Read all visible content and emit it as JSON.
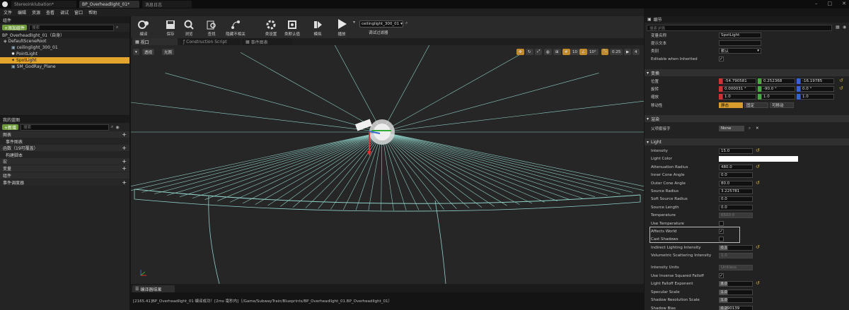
{
  "tabs": [
    {
      "label": "Stereoinklubation*"
    },
    {
      "label": "BP_OverheadlIght_01*"
    },
    {
      "label": "消息日志"
    }
  ],
  "menu": [
    "文件",
    "编辑",
    "资源",
    "查看",
    "调试",
    "窗口",
    "帮助"
  ],
  "components": {
    "header": "组件",
    "add_button": "+添加组件",
    "search_placeholder": "搜索",
    "root": "BP_OverheadlIght_01（自身）",
    "items": [
      "DefaultSceneRoot",
      "ceilinglight_300_01",
      "PointLight",
      "SpotLight",
      "SM_GodRay_Plane"
    ]
  },
  "my_blueprint": {
    "header": "我的蓝图",
    "add_button": "+新增",
    "search_placeholder": "搜索",
    "categories": [
      {
        "label": "图表",
        "sub": "事件图表"
      },
      {
        "label": "函数（19可覆盖）",
        "sub": "构建脚本"
      },
      {
        "label": "宏",
        "sub": ""
      },
      {
        "label": "变量",
        "sub": ""
      },
      {
        "label": "组件",
        "sub": "事件调度器"
      }
    ]
  },
  "toolbar": [
    {
      "label": "编译",
      "icon": "compile-icon"
    },
    {
      "label": "保存",
      "icon": "save-icon"
    },
    {
      "label": "浏览",
      "icon": "browse-icon"
    },
    {
      "label": "查找",
      "icon": "find-icon"
    },
    {
      "label": "隐藏不相关",
      "icon": "hide-unrelated-icon"
    },
    {
      "label": "类设置",
      "icon": "class-settings-icon"
    },
    {
      "label": "类默认值",
      "icon": "class-defaults-icon"
    },
    {
      "label": "模拟",
      "icon": "simulate-icon"
    },
    {
      "label": "播放",
      "icon": "play-icon"
    }
  ],
  "debug_filter": {
    "value": "ceilinglight_300_01",
    "label": "调试过滤器"
  },
  "editor_tabs": [
    "视口",
    "Construction Script",
    "事件图表"
  ],
  "viewport": {
    "perspective": "透视",
    "lit": "光照",
    "grid_snap": "10",
    "rot_snap": "10°",
    "scale_snap": "0.25",
    "cam_speed": "4"
  },
  "compiler": {
    "header": "编译器结果",
    "log": "[2165.41]BP_OverheadlIght_01 编译成功！[2ms 毫秒内]（/Game/SubwayTrain/Blueprints/BP_OverheadlIght_01.BP_OverheadlIght_01）"
  },
  "details": {
    "header": "细节",
    "search_placeholder": "搜索详情",
    "top_rows": [
      {
        "label": "变量名称",
        "value": "SpotLight"
      },
      {
        "label": "提示文本",
        "value": ""
      },
      {
        "label": "类别",
        "value": "默认"
      },
      {
        "label": "Editable when Inherited",
        "value": "✓"
      }
    ],
    "transform": {
      "title": "变换",
      "location": {
        "label": "位置",
        "x": "-54.790581",
        "y": "0.252368",
        "z": "-16.19785"
      },
      "rotation": {
        "label": "旋转",
        "x": "0.000031 °",
        "y": "-90.0 °",
        "z": "0.0 °"
      },
      "scale": {
        "label": "缩放",
        "x": "1.0",
        "y": "1.0",
        "z": "1.0"
      },
      "mobility": {
        "label": "移动性",
        "options": [
          "静态",
          "固定",
          "可移动"
        ]
      }
    },
    "tags": {
      "title": "渲染",
      "label": "父项套接字",
      "value": "None"
    },
    "light": {
      "title": "Light",
      "rows": [
        {
          "label": "Intensity",
          "value": "15.0"
        },
        {
          "label": "Light Color",
          "value": ""
        },
        {
          "label": "Attenuation Radius",
          "value": "480.0"
        },
        {
          "label": "Inner Cone Angle",
          "value": "0.0"
        },
        {
          "label": "Outer Cone Angle",
          "value": "80.0"
        },
        {
          "label": "Source Radius",
          "value": "3.225781"
        },
        {
          "label": "Soft Source Radius",
          "value": "0.0"
        },
        {
          "label": "Source Length",
          "value": "0.0"
        },
        {
          "label": "Temperature",
          "value": "6500.0"
        },
        {
          "label": "Use Temperature",
          "value": ""
        },
        {
          "label": "Affects World",
          "value": "✓"
        },
        {
          "label": "Cast Shadows",
          "value": ""
        },
        {
          "label": "Indirect Lighting Intensity",
          "value": "0.1"
        },
        {
          "label": "Volumetric Scattering Intensity",
          "value": "1.0"
        }
      ],
      "rows2": [
        {
          "label": "Intensity Units",
          "value": "Unitless"
        },
        {
          "label": "Use Inverse Squared Falloff",
          "value": "✓"
        },
        {
          "label": "Light Falloff Exponent",
          "value": "8.0"
        },
        {
          "label": "Specular Scale",
          "value": "1.0"
        },
        {
          "label": "Shadow Resolution Scale",
          "value": "1.0"
        },
        {
          "label": "Shadow Bias",
          "value": "0.290139"
        }
      ]
    }
  }
}
